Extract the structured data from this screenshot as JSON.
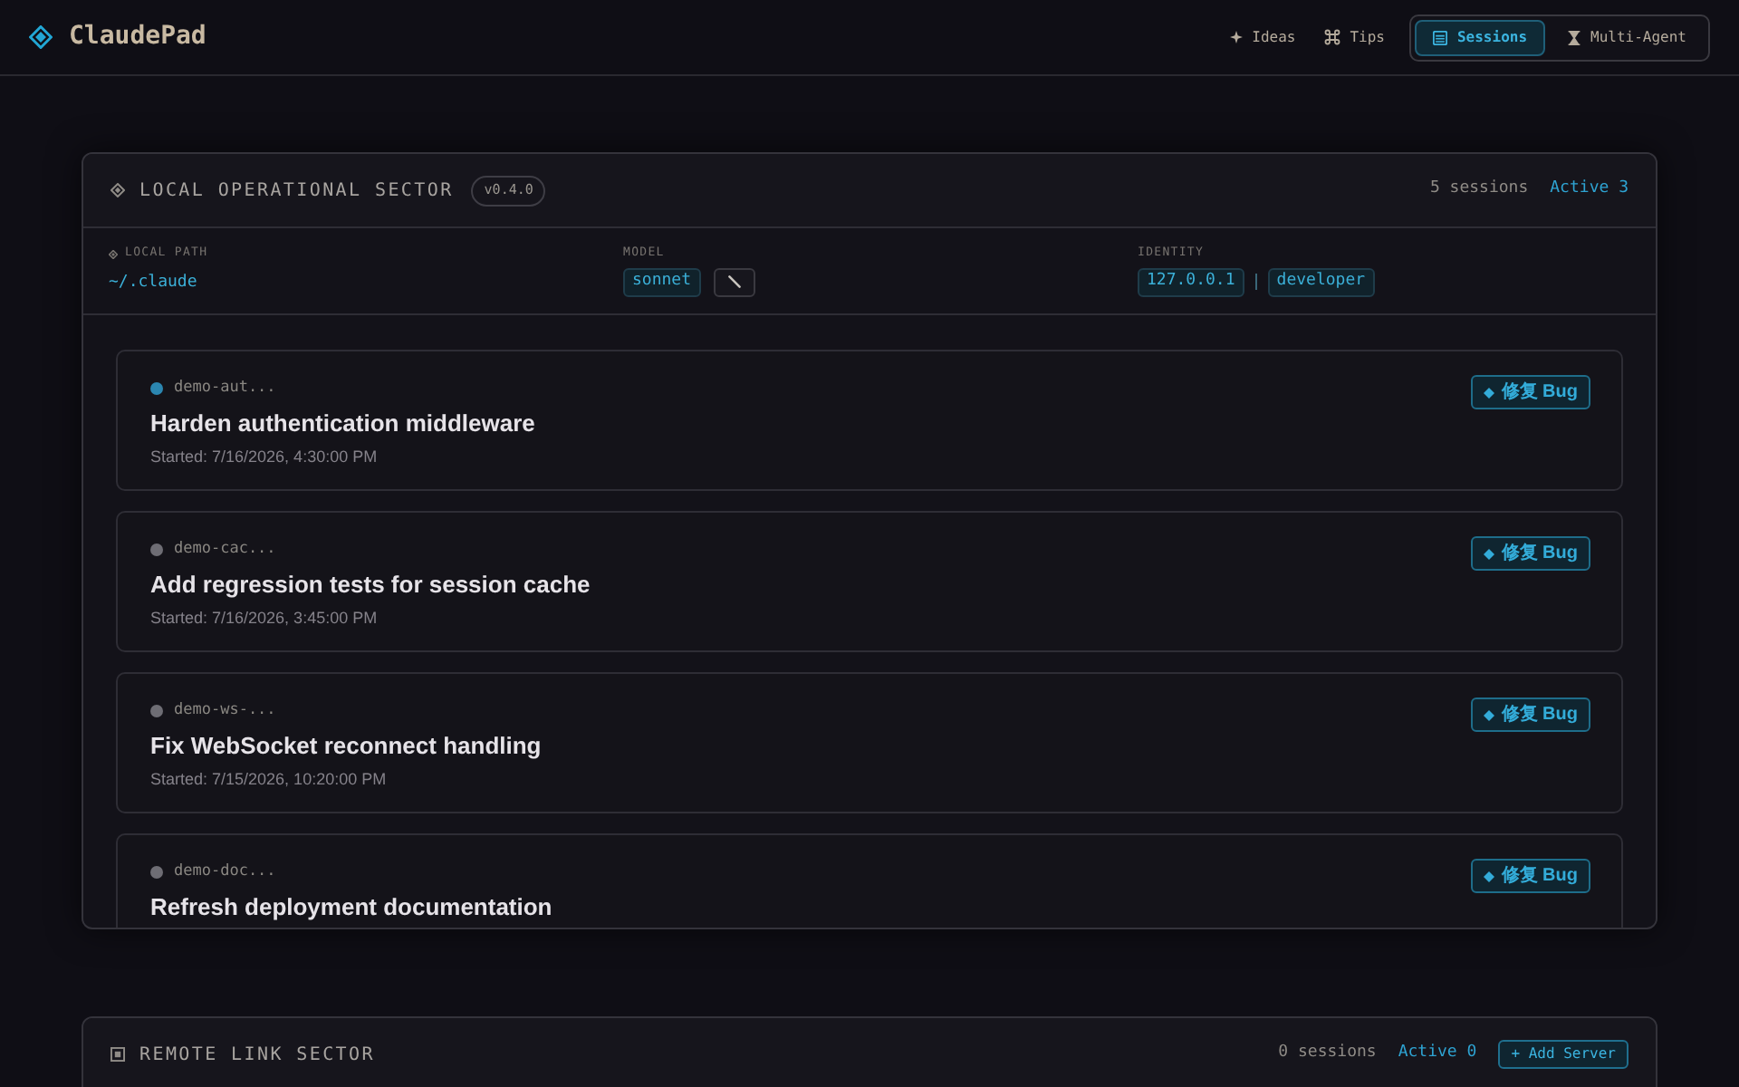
{
  "app": {
    "title": "ClaudePad"
  },
  "nav_links": [
    {
      "label": "Ideas"
    },
    {
      "label": "Tips"
    }
  ],
  "view_tabs": [
    {
      "label": "Sessions",
      "selected": true
    },
    {
      "label": "Multi-Agent",
      "selected": false
    }
  ],
  "local_sector": {
    "title": "LOCAL OPERATIONAL SECTOR",
    "version": "v0.4.0",
    "session_count": "5 sessions",
    "active_count": "Active 3",
    "local_path": {
      "label": "LOCAL PATH",
      "value": "~/.claude"
    },
    "model": {
      "label": "MODEL",
      "value": "sonnet"
    },
    "identity": {
      "label": "IDENTITY",
      "host": "127.0.0.1",
      "user": "developer"
    },
    "sessions": [
      {
        "id": "demo-aut...",
        "title": "Harden authentication middleware",
        "started": "Started: 7/16/2026, 4:30:00 PM",
        "color": "#2b86b0",
        "action": "修复 Bug"
      },
      {
        "id": "demo-cac...",
        "title": "Add regression tests for session cache",
        "started": "Started: 7/16/2026, 3:45:00 PM",
        "color": "#6e6d74",
        "action": "修复 Bug"
      },
      {
        "id": "demo-ws-...",
        "title": "Fix WebSocket reconnect handling",
        "started": "Started: 7/15/2026, 10:20:00 PM",
        "color": "#6e6d74",
        "action": "修复 Bug"
      },
      {
        "id": "demo-doc...",
        "title": "Refresh deployment documentation",
        "color": "#6e6d74",
        "action": "修复 Bug"
      }
    ]
  },
  "remote_sector": {
    "title": "REMOTE LINK SECTOR",
    "session_count": "0 sessions",
    "active_count": "Active 0",
    "add_button": "+ Add Server"
  }
}
